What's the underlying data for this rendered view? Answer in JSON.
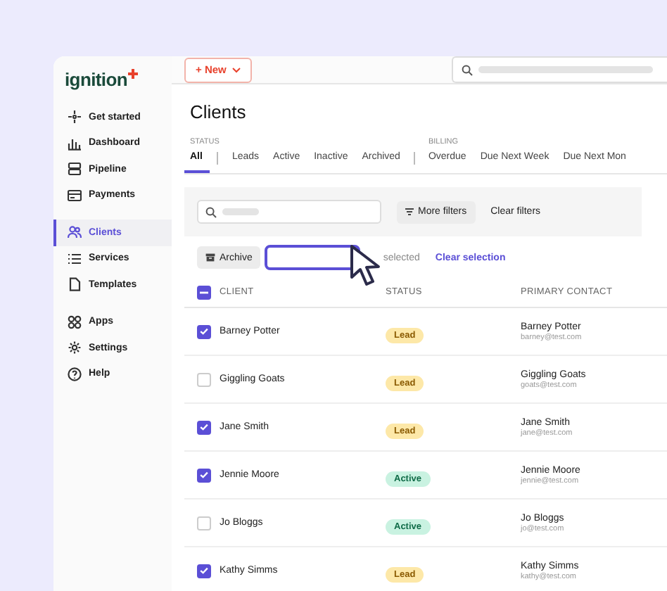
{
  "sidebar": {
    "logo": "ignition",
    "groups": [
      [
        {
          "label": "Get started",
          "selected": false
        },
        {
          "label": "Dashboard",
          "selected": false
        },
        {
          "label": "Pipeline",
          "selected": false
        },
        {
          "label": "Payments",
          "selected": false
        }
      ],
      [
        {
          "label": "Clients",
          "selected": true
        },
        {
          "label": "Services",
          "selected": false
        },
        {
          "label": "Templates",
          "selected": false
        }
      ],
      [
        {
          "label": "Apps",
          "selected": false
        },
        {
          "label": "Settings",
          "selected": false
        },
        {
          "label": "Help",
          "selected": false
        }
      ]
    ]
  },
  "topbar": {
    "new_button": "+ New"
  },
  "page_title": "Clients",
  "filter_groups": [
    {
      "label": "STATUS",
      "tabs": [
        {
          "label": "All",
          "selected": true
        },
        {
          "label": "Leads",
          "selected": false
        },
        {
          "label": "Active",
          "selected": false
        },
        {
          "label": "Inactive",
          "selected": false
        },
        {
          "label": "Archived",
          "selected": false
        }
      ]
    },
    {
      "label": "BILLING",
      "tabs": [
        {
          "label": "Overdue",
          "selected": false
        },
        {
          "label": "Due Next Week",
          "selected": false
        },
        {
          "label": "Due Next Mon",
          "selected": false
        }
      ]
    }
  ],
  "filters": {
    "more_filters": "More filters",
    "clear_filters": "Clear filters"
  },
  "bulk": {
    "archive": "Archive",
    "selected_count": "selected",
    "clear_selection": "Clear selection"
  },
  "table": {
    "columns": [
      "CLIENT",
      "STATUS",
      "PRIMARY CONTACT"
    ],
    "select_all_indeterminate": true,
    "rows": [
      {
        "client": "Barney Potter",
        "checked": true,
        "status": "Lead",
        "kind": "lead",
        "contact": "Barney Potter",
        "email": "barney@test.com"
      },
      {
        "client": "Giggling Goats",
        "checked": false,
        "status": "Lead",
        "kind": "lead",
        "contact": "Giggling Goats",
        "email": "goats@test.com"
      },
      {
        "client": "Jane Smith",
        "checked": true,
        "status": "Lead",
        "kind": "lead",
        "contact": "Jane Smith",
        "email": "jane@test.com"
      },
      {
        "client": "Jennie Moore",
        "checked": true,
        "status": "Active",
        "kind": "active",
        "contact": "Jennie Moore",
        "email": "jennie@test.com"
      },
      {
        "client": "Jo Bloggs",
        "checked": false,
        "status": "Active",
        "kind": "active",
        "contact": "Jo Bloggs",
        "email": "jo@test.com"
      },
      {
        "client": "Kathy Simms",
        "checked": true,
        "status": "Lead",
        "kind": "lead",
        "contact": "Kathy Simms",
        "email": "kathy@test.com"
      }
    ]
  }
}
